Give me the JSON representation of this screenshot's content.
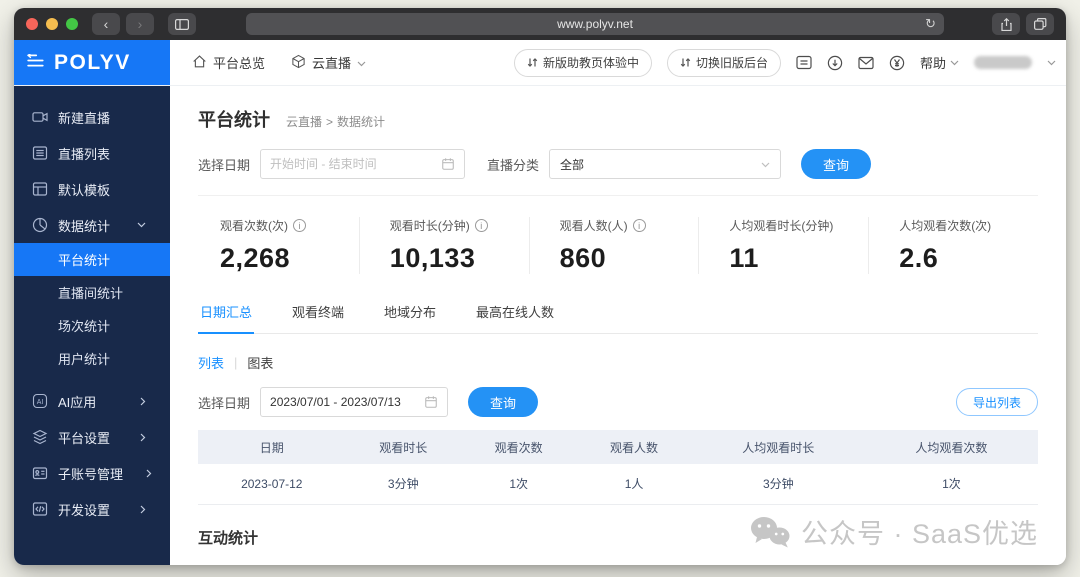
{
  "browser": {
    "url": "www.polyv.net"
  },
  "header": {
    "logo": "POLYV",
    "nav_overview": "平台总览",
    "nav_product": "云直播",
    "pill_new": "新版助教页体验中",
    "pill_old": "切换旧版后台",
    "help": "帮助"
  },
  "sidebar": {
    "items": [
      {
        "label": "新建直播"
      },
      {
        "label": "直播列表"
      },
      {
        "label": "默认模板"
      },
      {
        "label": "数据统计"
      },
      {
        "label": "AI应用"
      },
      {
        "label": "平台设置"
      },
      {
        "label": "子账号管理"
      },
      {
        "label": "开发设置"
      }
    ],
    "stats_children": [
      {
        "label": "平台统计"
      },
      {
        "label": "直播间统计"
      },
      {
        "label": "场次统计"
      },
      {
        "label": "用户统计"
      }
    ]
  },
  "page": {
    "title": "平台统计",
    "breadcrumb": [
      "云直播",
      "数据统计"
    ],
    "filters": {
      "date_label": "选择日期",
      "date_placeholder": "开始时间 - 结束时间",
      "category_label": "直播分类",
      "category_value": "全部",
      "query": "查询"
    },
    "stats": [
      {
        "label": "观看次数(次)",
        "value": "2,268"
      },
      {
        "label": "观看时长(分钟)",
        "value": "10,133"
      },
      {
        "label": "观看人数(人)",
        "value": "860"
      },
      {
        "label": "人均观看时长(分钟)",
        "value": "11"
      },
      {
        "label": "人均观看次数(次)",
        "value": "2.6"
      }
    ],
    "tabs": [
      {
        "label": "日期汇总"
      },
      {
        "label": "观看终端"
      },
      {
        "label": "地域分布"
      },
      {
        "label": "最高在线人数"
      }
    ],
    "view_toggle": {
      "list": "列表",
      "chart": "图表"
    },
    "table_filters": {
      "date_label": "选择日期",
      "date_value": "2023/07/01 - 2023/07/13",
      "query": "查询",
      "export": "导出列表"
    },
    "table": {
      "headers": [
        "日期",
        "观看时长",
        "观看次数",
        "观看人数",
        "人均观看时长",
        "人均观看次数"
      ],
      "rows": [
        [
          "2023-07-12",
          "3分钟",
          "1次",
          "1人",
          "3分钟",
          "1次"
        ]
      ]
    },
    "section_interaction": "互动统计",
    "watermark": "公众号 · SaaS优选"
  },
  "colors": {
    "accent": "#1677f6",
    "button_blue": "#2492f5",
    "sidebar_bg": "#18294a",
    "link_blue": "#1890ff"
  }
}
